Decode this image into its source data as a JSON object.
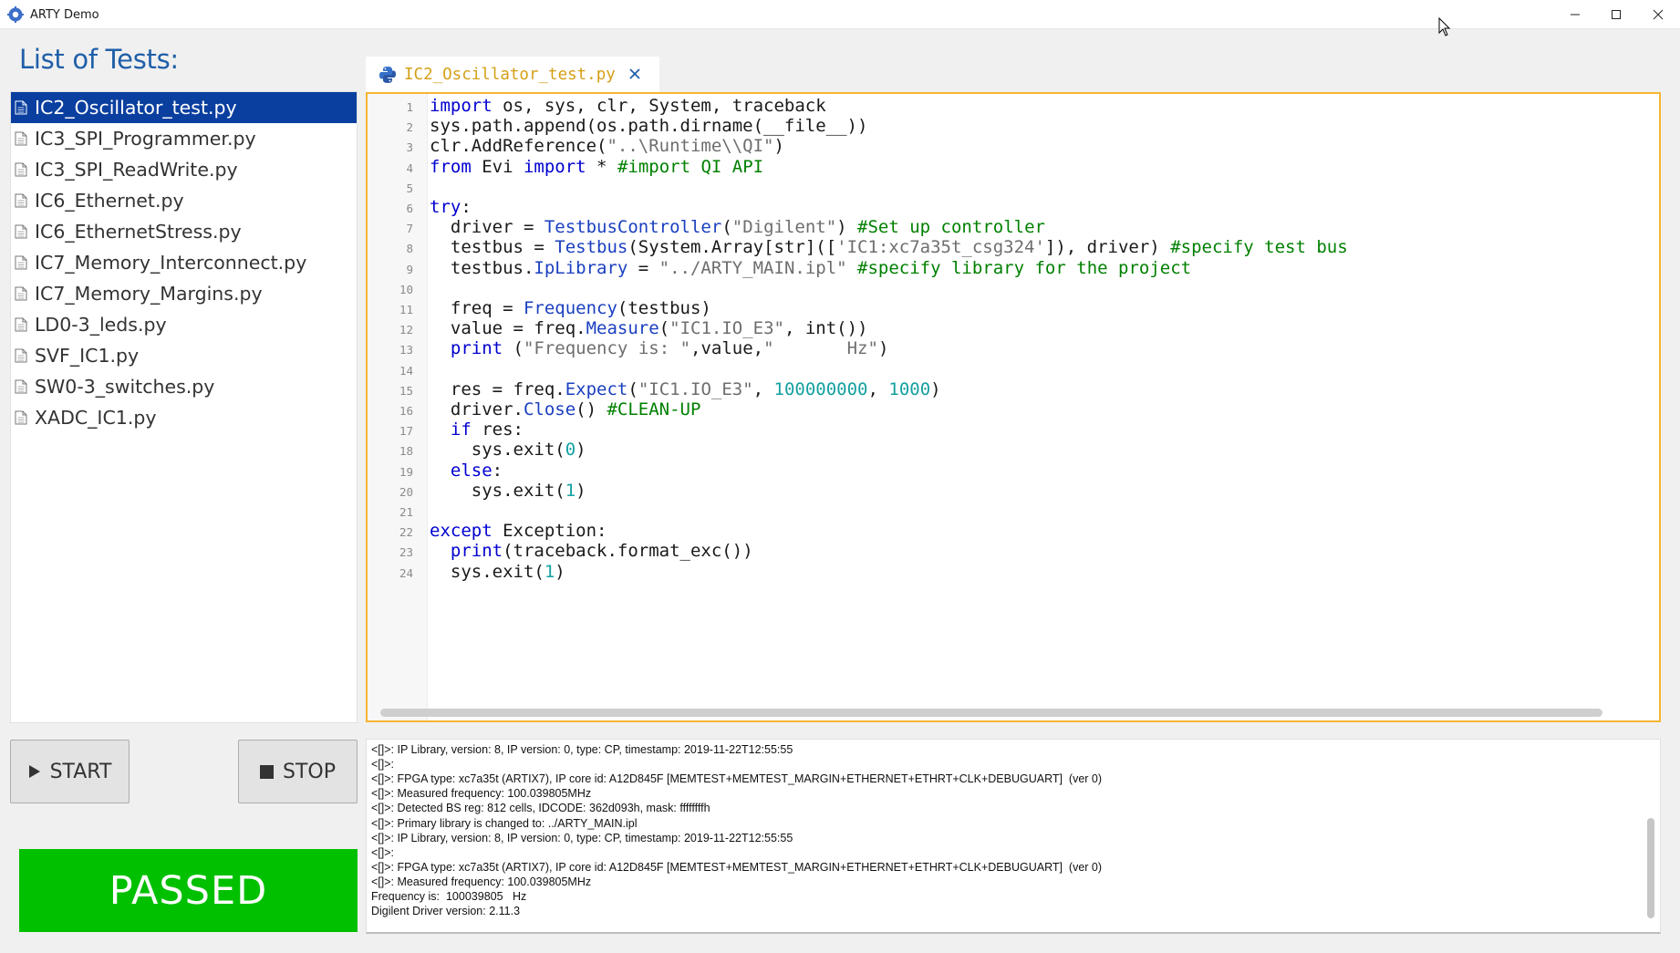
{
  "window": {
    "title": "ARTY Demo",
    "icon": "gear-cog-icon"
  },
  "tests": {
    "heading": "List of Tests:",
    "selected_index": 0,
    "items": [
      "IC2_Oscillator_test.py",
      "IC3_SPI_Programmer.py",
      "IC3_SPI_ReadWrite.py",
      "IC6_Ethernet.py",
      "IC6_EthernetStress.py",
      "IC7_Memory_Interconnect.py",
      "IC7_Memory_Margins.py",
      "LD0-3_leds.py",
      "SVF_IC1.py",
      "SW0-3_switches.py",
      "XADC_IC1.py"
    ]
  },
  "controls": {
    "start_label": "START",
    "stop_label": "STOP"
  },
  "status": {
    "label": "PASSED",
    "color": "#00c000"
  },
  "editor": {
    "tab_title": "IC2_Oscillator_test.py",
    "accent_color": "#f5b633",
    "lines": [
      [
        [
          "kw",
          "import"
        ],
        [
          "t",
          " os, sys, clr, System, traceback"
        ]
      ],
      [
        [
          "t",
          "sys.path.append(os.path.dirname(__file__))"
        ]
      ],
      [
        [
          "t",
          "clr.AddReference("
        ],
        [
          "str",
          "\"..\\Runtime\\\\QI\""
        ],
        [
          "t",
          ")"
        ]
      ],
      [
        [
          "kw",
          "from"
        ],
        [
          "t",
          " Evi "
        ],
        [
          "kw",
          "import"
        ],
        [
          "t",
          " * "
        ],
        [
          "cm",
          "#import QI API"
        ]
      ],
      [],
      [
        [
          "kw",
          "try"
        ],
        [
          "t",
          ":"
        ]
      ],
      [
        [
          "t",
          "  driver = "
        ],
        [
          "fn",
          "TestbusController"
        ],
        [
          "t",
          "("
        ],
        [
          "str",
          "\"Digilent\""
        ],
        [
          "t",
          ") "
        ],
        [
          "cm",
          "#Set up controller"
        ]
      ],
      [
        [
          "t",
          "  testbus = "
        ],
        [
          "fn",
          "Testbus"
        ],
        [
          "t",
          "(System.Array[str](["
        ],
        [
          "str",
          "'IC1:xc7a35t_csg324'"
        ],
        [
          "t",
          "]), driver) "
        ],
        [
          "cm",
          "#specify test bus"
        ]
      ],
      [
        [
          "t",
          "  testbus."
        ],
        [
          "fn",
          "IpLibrary"
        ],
        [
          "t",
          " = "
        ],
        [
          "str",
          "\"../ARTY_MAIN.ipl\""
        ],
        [
          "t",
          " "
        ],
        [
          "cm",
          "#specify library for the project"
        ]
      ],
      [],
      [
        [
          "t",
          "  freq = "
        ],
        [
          "fn",
          "Frequency"
        ],
        [
          "t",
          "(testbus)"
        ]
      ],
      [
        [
          "t",
          "  value = freq."
        ],
        [
          "fn",
          "Measure"
        ],
        [
          "t",
          "("
        ],
        [
          "str",
          "\"IC1.IO_E3\""
        ],
        [
          "t",
          ", int())"
        ]
      ],
      [
        [
          "t",
          "  "
        ],
        [
          "kw",
          "print"
        ],
        [
          "t",
          " ("
        ],
        [
          "str",
          "\"Frequency is: \""
        ],
        [
          "t",
          ",value,"
        ],
        [
          "str",
          "\"       Hz\""
        ],
        [
          "t",
          ")"
        ]
      ],
      [],
      [
        [
          "t",
          "  res = freq."
        ],
        [
          "fn",
          "Expect"
        ],
        [
          "t",
          "("
        ],
        [
          "str",
          "\"IC1.IO_E3\""
        ],
        [
          "t",
          ", "
        ],
        [
          "num",
          "100000000"
        ],
        [
          "t",
          ", "
        ],
        [
          "num",
          "1000"
        ],
        [
          "t",
          ")"
        ]
      ],
      [
        [
          "t",
          "  driver."
        ],
        [
          "fn",
          "Close"
        ],
        [
          "t",
          "() "
        ],
        [
          "cm",
          "#CLEAN-UP"
        ]
      ],
      [
        [
          "t",
          "  "
        ],
        [
          "kw",
          "if"
        ],
        [
          "t",
          " res:"
        ]
      ],
      [
        [
          "t",
          "    sys.exit("
        ],
        [
          "num",
          "0"
        ],
        [
          "t",
          ")"
        ]
      ],
      [
        [
          "t",
          "  "
        ],
        [
          "kw",
          "else"
        ],
        [
          "t",
          ":"
        ]
      ],
      [
        [
          "t",
          "    sys.exit("
        ],
        [
          "num",
          "1"
        ],
        [
          "t",
          ")"
        ]
      ],
      [],
      [
        [
          "kw",
          "except"
        ],
        [
          "t",
          " Exception:"
        ]
      ],
      [
        [
          "t",
          "  "
        ],
        [
          "kw",
          "print"
        ],
        [
          "t",
          "(traceback.format_exc())"
        ]
      ],
      [
        [
          "t",
          "  sys.exit("
        ],
        [
          "num",
          "1"
        ],
        [
          "t",
          ")"
        ]
      ]
    ]
  },
  "log": {
    "lines": [
      "<[]>: IP Library, version: 8, IP version: 0, type: CP, timestamp: 2019-11-22T12:55:55",
      "<[]>:",
      "<[]>: FPGA type: xc7a35t (ARTIX7), IP core id: A12D845F [MEMTEST+MEMTEST_MARGIN+ETHERNET+ETHRT+CLK+DEBUGUART]  (ver 0)",
      "<[]>: Measured frequency: 100.039805MHz",
      "<[]>: Detected BS reg: 812 cells, IDCODE: 362d093h, mask: ffffffffh",
      "<[]>: Primary library is changed to: ../ARTY_MAIN.ipl",
      "<[]>: IP Library, version: 8, IP version: 0, type: CP, timestamp: 2019-11-22T12:55:55",
      "<[]>:",
      "<[]>: FPGA type: xc7a35t (ARTIX7), IP core id: A12D845F [MEMTEST+MEMTEST_MARGIN+ETHERNET+ETHRT+CLK+DEBUGUART]  (ver 0)",
      "<[]>: Measured frequency: 100.039805MHz",
      "Frequency is:  100039805   Hz",
      "Digilent Driver version: 2.11.3"
    ]
  }
}
